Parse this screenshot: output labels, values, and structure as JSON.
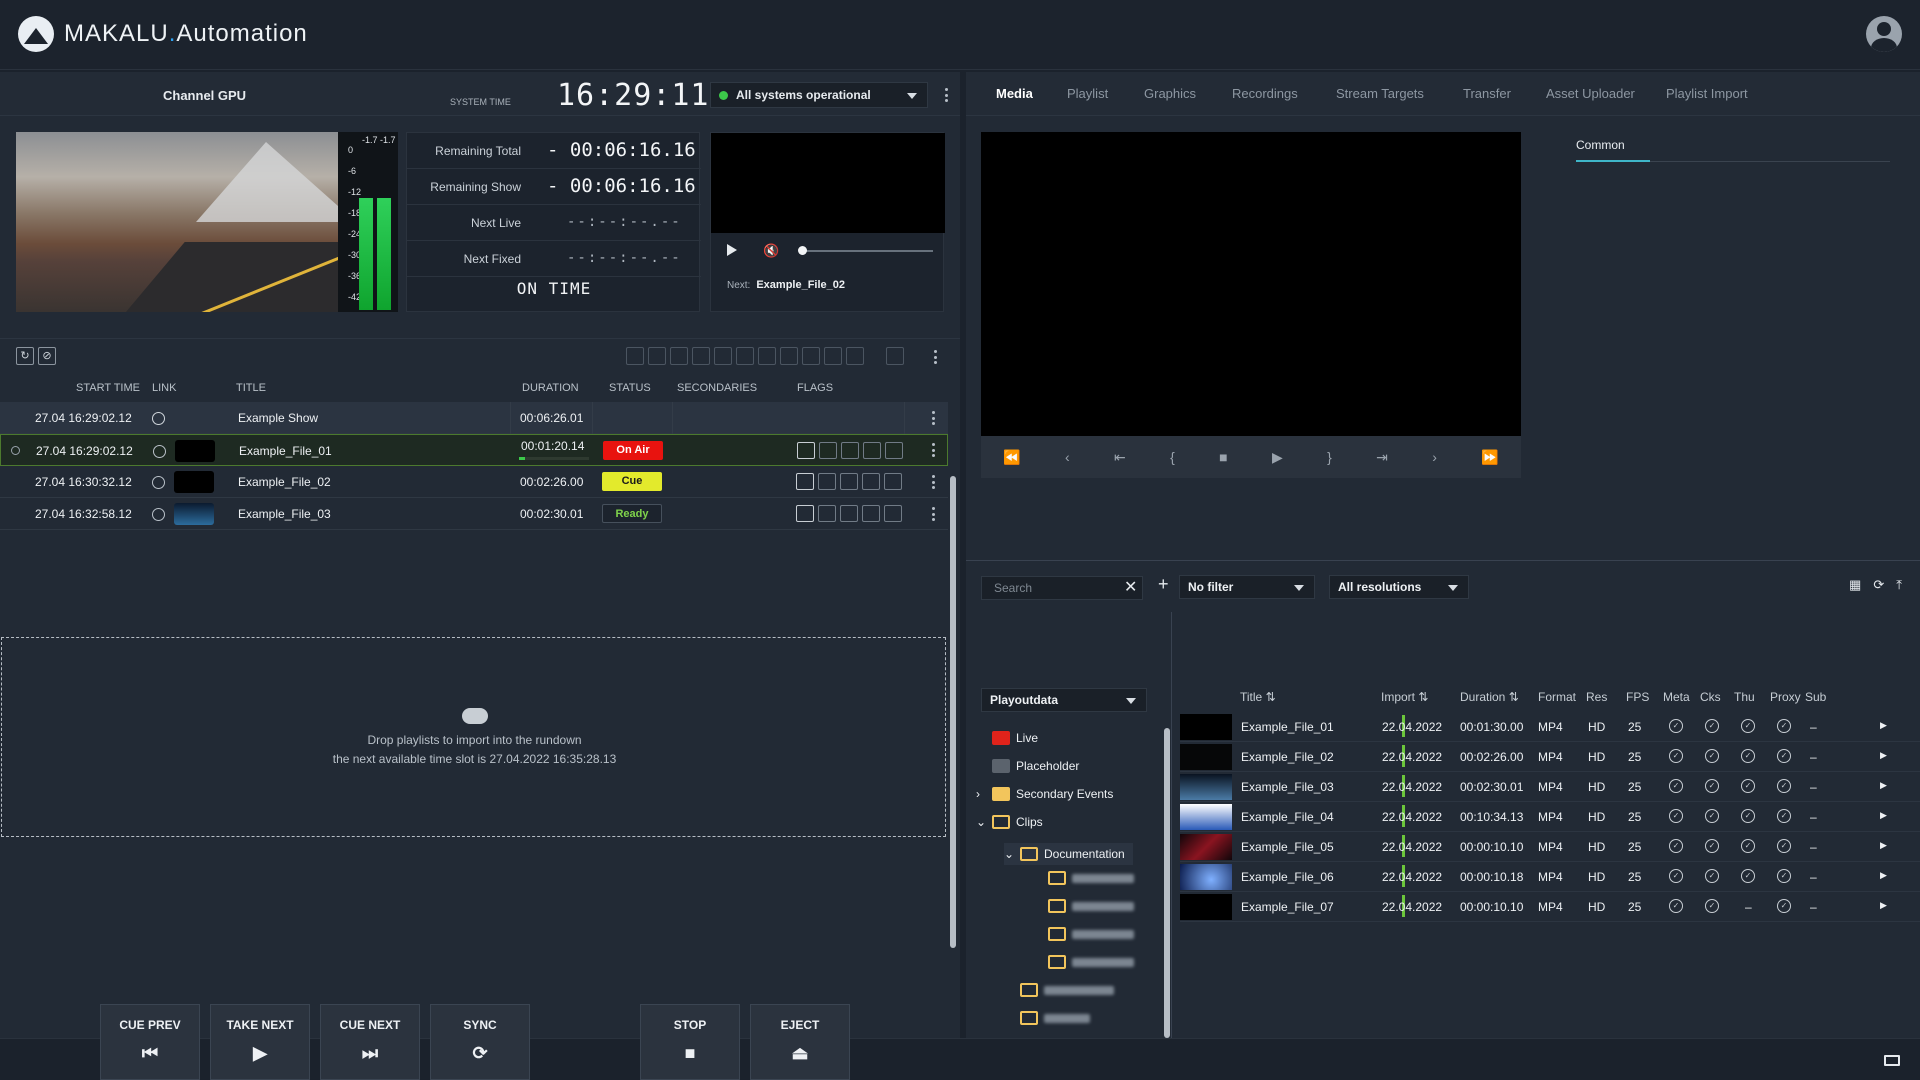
{
  "app": {
    "brand_main": "MAKALU",
    "brand_dot": ".",
    "brand_suffix": "Automation"
  },
  "channel": {
    "title": "Channel GPU",
    "system_time_label": "SYSTEM TIME",
    "system_time": "16:29:11",
    "status": "All systems operational",
    "status_color": "#3cc94a"
  },
  "meter": {
    "scale": [
      "0",
      "-6",
      "-12",
      "-18",
      "-24",
      "-30",
      "-36",
      "-42"
    ],
    "peak_l": "-1.7",
    "peak_r": "-1.7",
    "level_l": 0.62,
    "level_r": 0.62
  },
  "timers": {
    "remaining_total_label": "Remaining Total",
    "remaining_total": "- 00:06:16.16",
    "remaining_show_label": "Remaining Show",
    "remaining_show": "- 00:06:16.16",
    "next_live_label": "Next Live",
    "next_live": "--:--:--.--",
    "next_fixed_label": "Next Fixed",
    "next_fixed": "--:--:--.--",
    "on_time": "ON TIME"
  },
  "preview": {
    "next_label": "Next:",
    "next_value": "Example_File_02",
    "progress": 0.02
  },
  "rundown": {
    "headers": {
      "start_time": "START TIME",
      "link": "LINK",
      "title": "TITLE",
      "duration": "DURATION",
      "status": "STATUS",
      "secondaries": "SECONDARIES",
      "flags": "FLAGS"
    },
    "rows": [
      {
        "start": "27.04  16:29:02.12",
        "title": "Example Show",
        "duration": "00:06:26.01",
        "status": ""
      },
      {
        "start": "27.04  16:29:02.12",
        "title": "Example_File_01",
        "duration": "00:01:20.14",
        "status": "On Air",
        "status_bg": "#e8130f",
        "status_fg": "#ffffff",
        "progress": 0.08
      },
      {
        "start": "27.04  16:30:32.12",
        "title": "Example_File_02",
        "duration": "00:02:26.00",
        "status": "Cue",
        "status_bg": "#e3ea2c",
        "status_fg": "#1a1a1a"
      },
      {
        "start": "27.04  16:32:58.12",
        "title": "Example_File_03",
        "duration": "00:02:30.01",
        "status": "Ready",
        "status_bg": "#1c232d",
        "status_fg": "#7fd34b"
      }
    ],
    "drop_line1": "Drop playlists to import into the rundown",
    "drop_line2": "the next available time slot is 27.04.2022 16:35:28.13"
  },
  "controls": {
    "cue_prev": "CUE PREV",
    "take_next": "TAKE NEXT",
    "cue_next": "CUE NEXT",
    "sync": "SYNC",
    "stop": "STOP",
    "eject": "EJECT"
  },
  "tabs": [
    "Media",
    "Playlist",
    "Graphics",
    "Recordings",
    "Stream Targets",
    "Transfer",
    "Asset Uploader",
    "Playlist Import"
  ],
  "common_tab": "Common",
  "media": {
    "search_placeholder": "Search",
    "filter": "No filter",
    "resolution": "All resolutions",
    "source": "Playoutdata",
    "tree": {
      "live": "Live",
      "placeholder": "Placeholder",
      "secondary_events": "Secondary Events",
      "clips": "Clips",
      "documentation": "Documentation"
    },
    "headers": {
      "title": "Title",
      "import": "Import",
      "duration": "Duration",
      "format": "Format",
      "res": "Res",
      "fps": "FPS",
      "meta": "Meta",
      "cks": "Cks",
      "thu": "Thu",
      "proxy": "Proxy",
      "sub": "Sub"
    },
    "rows": [
      {
        "title": "Example_File_01",
        "import": "22.04.2022",
        "duration": "00:01:30.00",
        "format": "MP4",
        "res": "HD",
        "fps": "25",
        "thu": true,
        "sub": "–"
      },
      {
        "title": "Example_File_02",
        "import": "22.04.2022",
        "duration": "00:02:26.00",
        "format": "MP4",
        "res": "HD",
        "fps": "25",
        "thu": true,
        "sub": "–"
      },
      {
        "title": "Example_File_03",
        "import": "22.04.2022",
        "duration": "00:02:30.01",
        "format": "MP4",
        "res": "HD",
        "fps": "25",
        "thu": true,
        "sub": "–"
      },
      {
        "title": "Example_File_04",
        "import": "22.04.2022",
        "duration": "00:10:34.13",
        "format": "MP4",
        "res": "HD",
        "fps": "25",
        "thu": true,
        "sub": "–"
      },
      {
        "title": "Example_File_05",
        "import": "22.04.2022",
        "duration": "00:00:10.10",
        "format": "MP4",
        "res": "HD",
        "fps": "25",
        "thu": true,
        "sub": "–"
      },
      {
        "title": "Example_File_06",
        "import": "22.04.2022",
        "duration": "00:00:10.18",
        "format": "MP4",
        "res": "HD",
        "fps": "25",
        "thu": true,
        "sub": "–"
      },
      {
        "title": "Example_File_07",
        "import": "22.04.2022",
        "duration": "00:00:10.10",
        "format": "MP4",
        "res": "HD",
        "fps": "25",
        "thu": false,
        "thu_text": "–",
        "sub": "–"
      }
    ]
  }
}
